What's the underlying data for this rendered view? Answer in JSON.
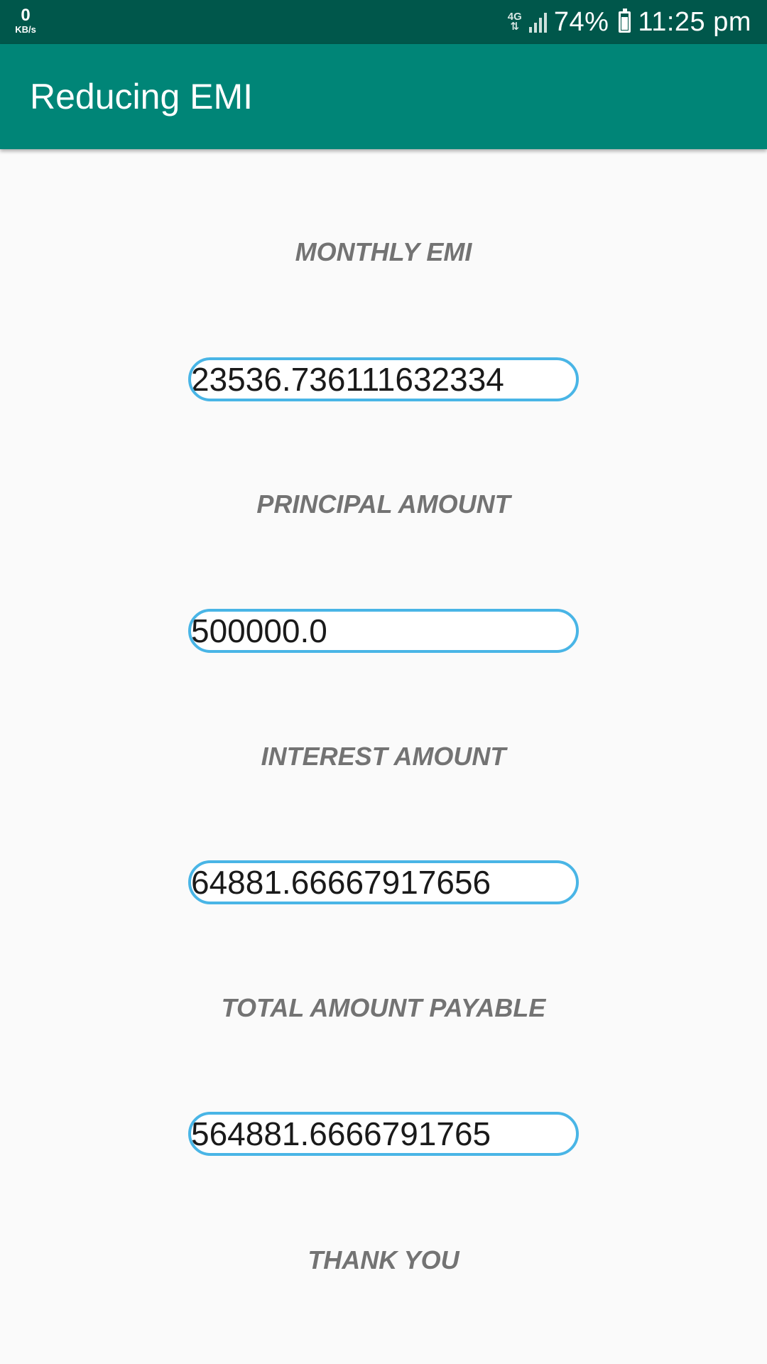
{
  "status_bar": {
    "network_speed": "0",
    "network_unit": "KB/s",
    "network_type": "4G",
    "battery": "74%",
    "time": "11:25 pm",
    "icons": [
      "network-type-icon",
      "signal-icon",
      "battery-icon"
    ]
  },
  "app_bar": {
    "title": "Reducing EMI"
  },
  "colors": {
    "status_bar": "#00574b",
    "app_bar": "#008577",
    "field_border": "#49b5e6",
    "label_text": "#737373"
  },
  "results": {
    "monthly_emi": {
      "label": "MONTHLY EMI",
      "value": "23536.736111632334"
    },
    "principal_amount": {
      "label": "PRINCIPAL AMOUNT",
      "value": "500000.0"
    },
    "interest_amount": {
      "label": "INTEREST AMOUNT",
      "value": "64881.66667917656"
    },
    "total_amount_payable": {
      "label": "TOTAL AMOUNT PAYABLE",
      "value": "564881.6666791765"
    }
  },
  "footer": {
    "thank_you": "THANK YOU"
  }
}
